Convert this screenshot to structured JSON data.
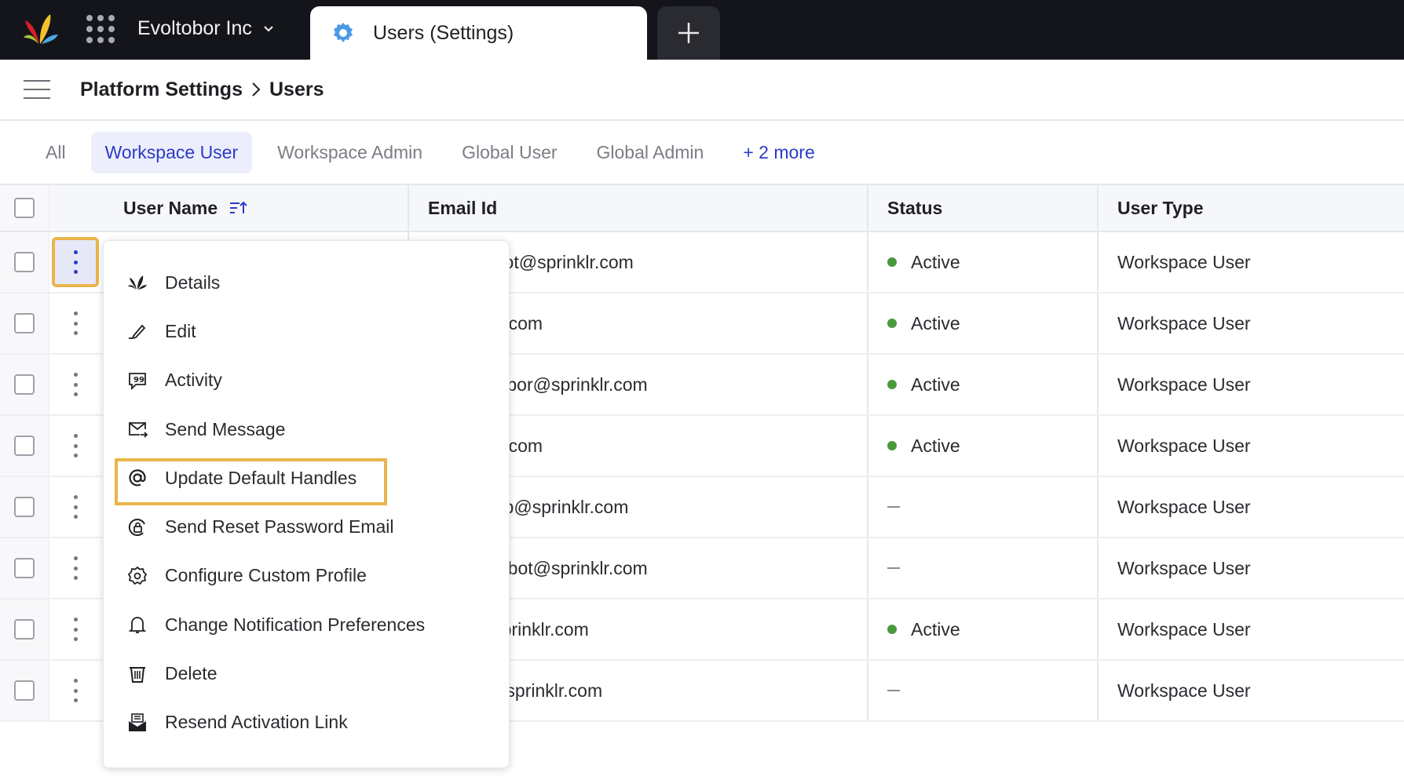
{
  "topbar": {
    "org_name": "Evoltobor Inc",
    "active_tab_title": "Users (Settings)",
    "add_tab_label": "+"
  },
  "breadcrumb": {
    "parent": "Platform Settings",
    "current": "Users"
  },
  "filters": [
    {
      "label": "All",
      "active": false
    },
    {
      "label": "Workspace User",
      "active": true
    },
    {
      "label": "Workspace Admin",
      "active": false
    },
    {
      "label": "Global User",
      "active": false
    },
    {
      "label": "Global Admin",
      "active": false
    },
    {
      "label": "+ 2 more",
      "active": false
    }
  ],
  "table": {
    "columns": [
      "User Name",
      "Email Id",
      "Status",
      "User Type"
    ],
    "rows": [
      {
        "email": "e+boxrobot@sprinklr.com",
        "status": "Active",
        "user_type": "Workspace User"
      },
      {
        "email": "@sprinklr.com",
        "status": "Active",
        "user_type": "Workspace User"
      },
      {
        "email": "on+evoltobor@sprinklr.com",
        "status": "Active",
        "user_type": "Workspace User"
      },
      {
        "email": "@sprinklr.com",
        "status": "Active",
        "user_type": "Workspace User"
      },
      {
        "email": "e+robocop@sprinklr.com",
        "status": "",
        "user_type": "Workspace User"
      },
      {
        "email": "e+scooterbot@sprinklr.com",
        "status": "",
        "user_type": "Workspace User"
      },
      {
        "email": "swipe@sprinklr.com",
        "status": "Active",
        "user_type": "Workspace User"
      },
      {
        "email": "e+tvbot@sprinklr.com",
        "status": "",
        "user_type": "Workspace User"
      }
    ]
  },
  "context_menu": {
    "items": [
      {
        "label": "Details",
        "icon": "sprinklr-logo-icon"
      },
      {
        "label": "Edit",
        "icon": "pencil-icon"
      },
      {
        "label": "Activity",
        "icon": "quote-bubble-icon"
      },
      {
        "label": "Send Message",
        "icon": "message-send-icon"
      },
      {
        "label": "Update Default Handles",
        "icon": "at-sign-icon",
        "highlighted": true
      },
      {
        "label": "Send Reset Password Email",
        "icon": "reset-password-icon"
      },
      {
        "label": "Configure Custom Profile",
        "icon": "gear-icon"
      },
      {
        "label": "Change Notification Preferences",
        "icon": "bell-icon"
      },
      {
        "label": "Delete",
        "icon": "trash-icon"
      },
      {
        "label": "Resend Activation Link",
        "icon": "envelope-open-icon"
      }
    ]
  },
  "colors": {
    "accent": "#2b3bc9",
    "active_status": "#4a9a3d",
    "highlight_outline": "#e9b54a",
    "topbar_bg": "#14151b"
  }
}
